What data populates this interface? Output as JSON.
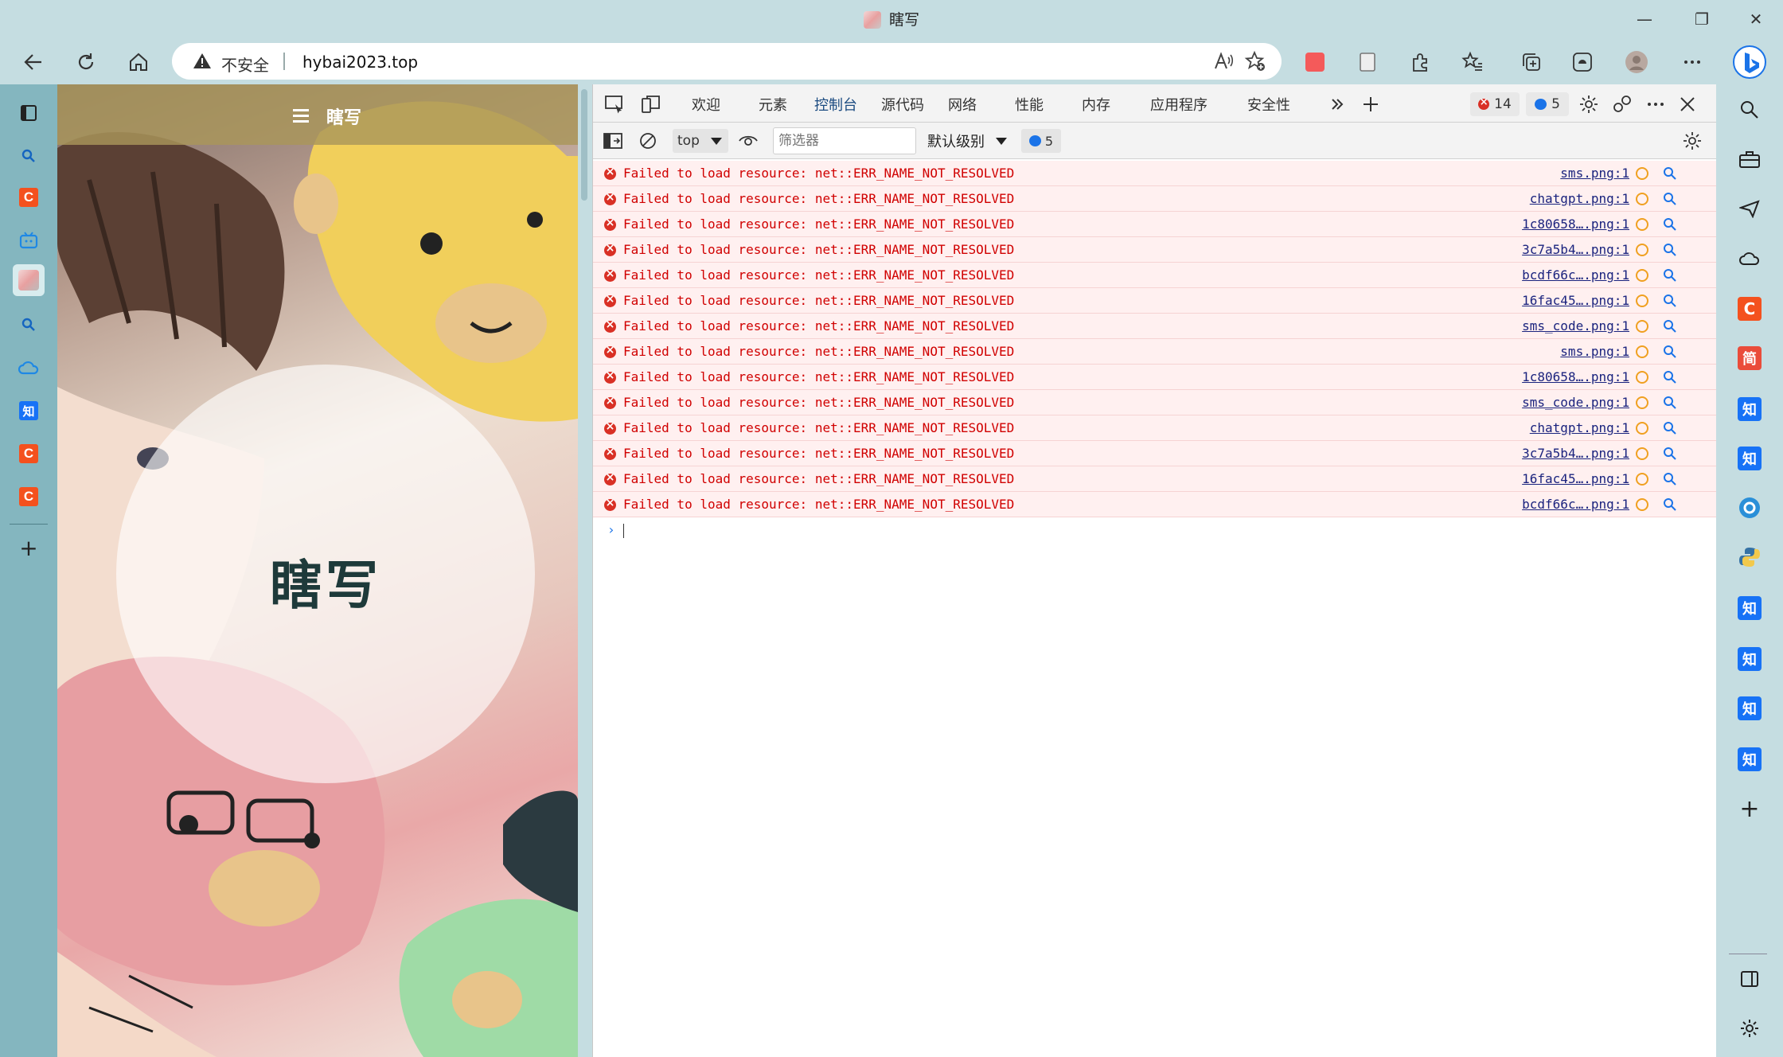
{
  "window": {
    "title": "瞎写",
    "minimize": "—",
    "maximize": "❐",
    "close": "✕"
  },
  "address": {
    "insecure_label": "不安全",
    "url": "hybai2023.top"
  },
  "page": {
    "header_brand": "瞎写",
    "hero_title": "瞎写"
  },
  "devtools": {
    "tabs": [
      "欢迎",
      "元素",
      "控制台",
      "源代码",
      "网络",
      "性能",
      "内存",
      "应用程序",
      "安全性"
    ],
    "active_tab": "控制台",
    "error_count": "14",
    "message_count": "5",
    "context": "top",
    "filter_placeholder": "筛选器",
    "level_label": "默认级别",
    "filter_message_count": "5",
    "messages": [
      {
        "text": "Failed to load resource: net::ERR_NAME_NOT_RESOLVED",
        "source": "sms.png:1"
      },
      {
        "text": "Failed to load resource: net::ERR_NAME_NOT_RESOLVED",
        "source": "chatgpt.png:1"
      },
      {
        "text": "Failed to load resource: net::ERR_NAME_NOT_RESOLVED",
        "source": "1c80658….png:1"
      },
      {
        "text": "Failed to load resource: net::ERR_NAME_NOT_RESOLVED",
        "source": "3c7a5b4….png:1"
      },
      {
        "text": "Failed to load resource: net::ERR_NAME_NOT_RESOLVED",
        "source": "bcdf66c….png:1"
      },
      {
        "text": "Failed to load resource: net::ERR_NAME_NOT_RESOLVED",
        "source": "16fac45….png:1"
      },
      {
        "text": "Failed to load resource: net::ERR_NAME_NOT_RESOLVED",
        "source": "sms_code.png:1"
      },
      {
        "text": "Failed to load resource: net::ERR_NAME_NOT_RESOLVED",
        "source": "sms.png:1"
      },
      {
        "text": "Failed to load resource: net::ERR_NAME_NOT_RESOLVED",
        "source": "1c80658….png:1"
      },
      {
        "text": "Failed to load resource: net::ERR_NAME_NOT_RESOLVED",
        "source": "sms_code.png:1"
      },
      {
        "text": "Failed to load resource: net::ERR_NAME_NOT_RESOLVED",
        "source": "chatgpt.png:1"
      },
      {
        "text": "Failed to load resource: net::ERR_NAME_NOT_RESOLVED",
        "source": "3c7a5b4….png:1"
      },
      {
        "text": "Failed to load resource: net::ERR_NAME_NOT_RESOLVED",
        "source": "16fac45….png:1"
      },
      {
        "text": "Failed to load resource: net::ERR_NAME_NOT_RESOLVED",
        "source": "bcdf66c….png:1"
      }
    ],
    "prompt_symbol": "›"
  },
  "left_sidebar": {
    "tiles": [
      {
        "icon": "c-icon",
        "label": "C",
        "color": "#f4511e"
      },
      {
        "icon": "zhihu-icon",
        "label": "知",
        "color": "#1772f6"
      },
      {
        "icon": "c-icon",
        "label": "C",
        "color": "#f4511e"
      },
      {
        "icon": "c-icon",
        "label": "C",
        "color": "#f4511e"
      }
    ],
    "add_label": "+"
  },
  "right_sidebar": {
    "tiles": [
      {
        "icon": "c-icon",
        "label": "C",
        "color": "#f4511e"
      },
      {
        "icon": "jian-icon",
        "label": "简",
        "color": "#ea4c3a"
      },
      {
        "icon": "zhihu-icon",
        "label": "知",
        "color": "#1772f6"
      },
      {
        "icon": "zhihu-icon",
        "label": "知",
        "color": "#1772f6"
      },
      {
        "icon": "zhihu-icon",
        "label": "知",
        "color": "#1772f6"
      },
      {
        "icon": "zhihu-icon",
        "label": "知",
        "color": "#1772f6"
      },
      {
        "icon": "zhihu-icon",
        "label": "知",
        "color": "#1772f6"
      },
      {
        "icon": "zhihu-icon",
        "label": "知",
        "color": "#1772f6"
      }
    ],
    "add_label": "+"
  },
  "colors": {
    "chrome_bg": "#c5dde1",
    "left_sidebar_bg": "#84b6bf",
    "error_text": "#d00000",
    "error_row_bg": "#fff0f0",
    "accent": "#0f6cbd"
  }
}
